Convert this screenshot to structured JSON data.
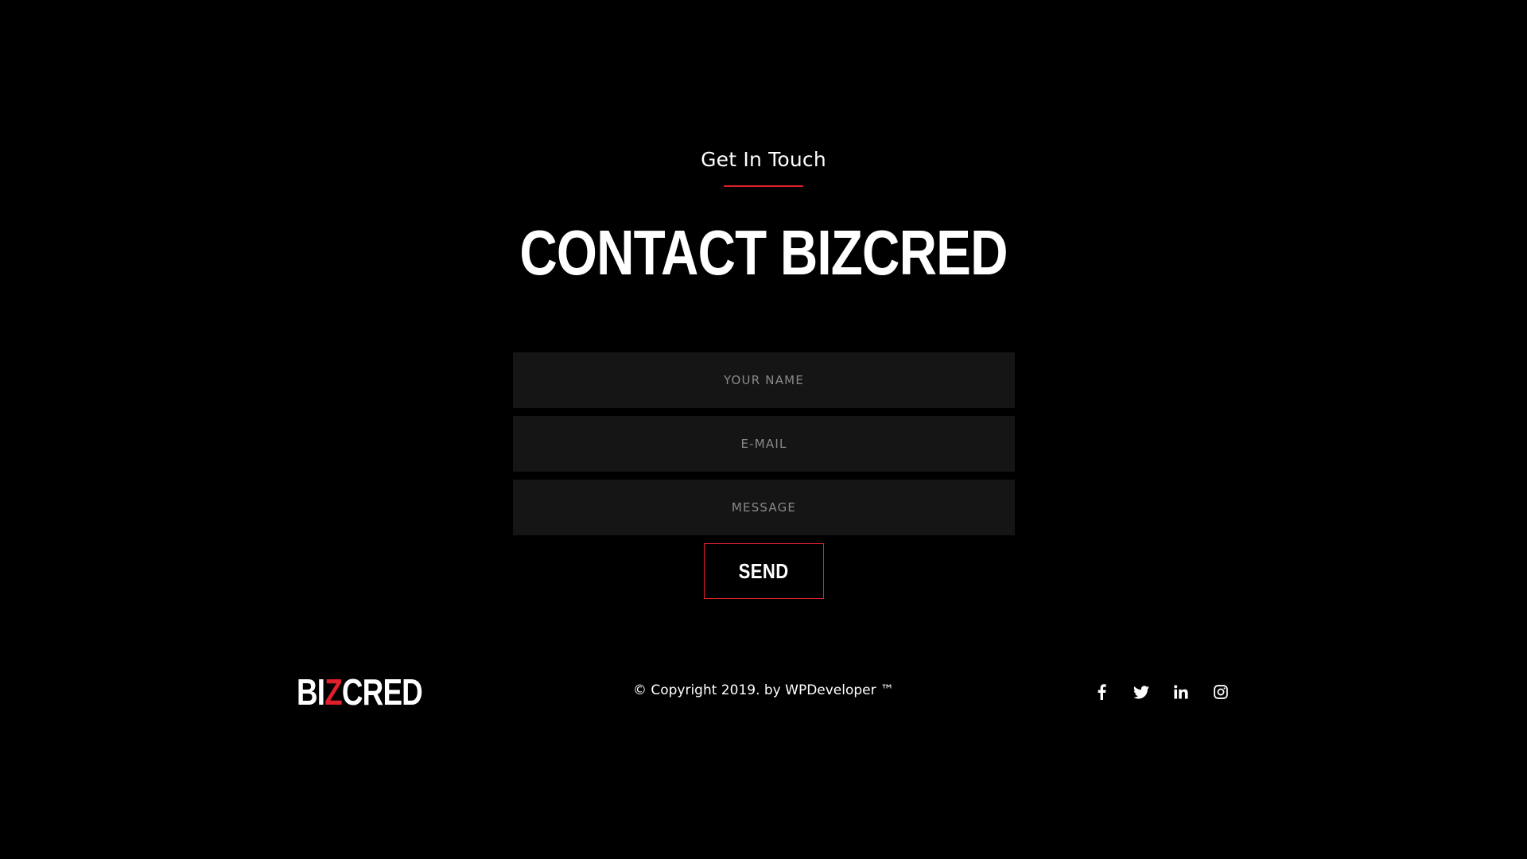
{
  "header": {
    "eyebrow": "Get In Touch",
    "title": "CONTACT BIZCRED"
  },
  "form": {
    "name_placeholder": "YOUR NAME",
    "email_placeholder": "E-MAIL",
    "message_placeholder": "MESSAGE",
    "send_label": "SEND"
  },
  "footer": {
    "logo": {
      "part1": "BI",
      "part2": "Z",
      "part3": "CRED"
    },
    "copyright": "© Copyright 2019. by WPDeveloper ™",
    "socials": [
      {
        "icon": "facebook-icon"
      },
      {
        "icon": "twitter-icon"
      },
      {
        "icon": "linkedin-icon"
      },
      {
        "icon": "instagram-icon"
      }
    ]
  },
  "colors": {
    "background": "#000000",
    "accent": "#e0202a",
    "field_background": "#151515",
    "placeholder": "#8a8a8a",
    "text": "#ffffff"
  }
}
